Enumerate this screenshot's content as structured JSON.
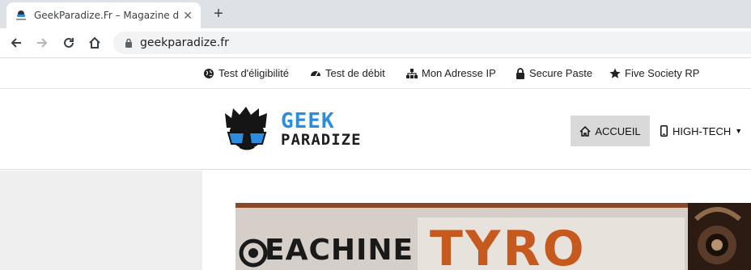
{
  "browser": {
    "tab_title": "GeekParadize.Fr – Magazine d'Actualité",
    "tab_close": "✕",
    "new_tab": "+",
    "url": "geekparadize.fr"
  },
  "topbar": {
    "links": [
      {
        "label": "Test d'éligibilité",
        "icon": "globe-icon"
      },
      {
        "label": "Test de débit",
        "icon": "speedometer-icon"
      },
      {
        "label": "Mon Adresse IP",
        "icon": "sitemap-icon"
      },
      {
        "label": "Secure Paste",
        "icon": "lock-icon"
      },
      {
        "label": "Five Society RP",
        "icon": "star-icon"
      }
    ]
  },
  "header": {
    "logo_line1": "GEEK",
    "logo_line2": "PARADIZE",
    "menu": [
      {
        "label": "ACCUEIL",
        "icon": "home-icon",
        "active": true
      },
      {
        "label": "HIGH-TECH",
        "icon": "mobile-icon",
        "dropdown": true
      }
    ],
    "dropdown_caret": "▼"
  },
  "hero": {
    "text_left": "EACHINE",
    "text_right": "TYRO"
  },
  "colors": {
    "logo_blue": "#2a8de0",
    "active_menu_bg": "#d9d9d9",
    "sidebar_bg": "#efefef"
  }
}
